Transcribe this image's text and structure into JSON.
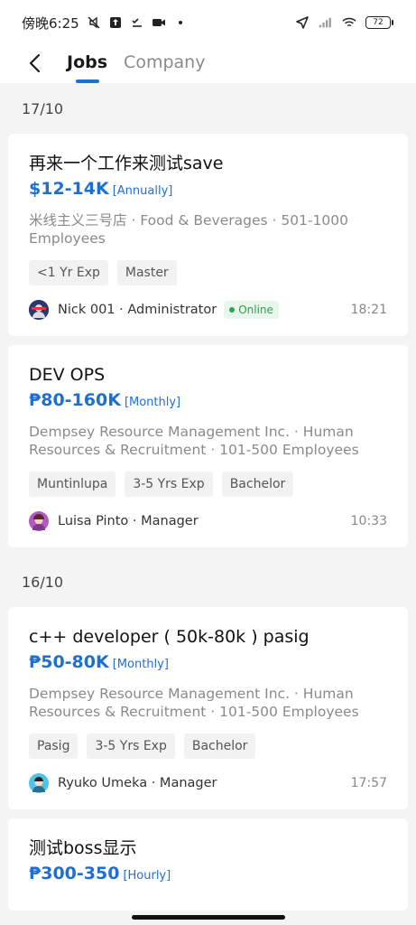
{
  "status_bar": {
    "time": "傍晚6:25",
    "battery": "72"
  },
  "nav": {
    "tabs": [
      {
        "label": "Jobs",
        "active": true
      },
      {
        "label": "Company",
        "active": false
      }
    ]
  },
  "groups": [
    {
      "date": "17/10",
      "jobs": [
        {
          "title": "再来一个工作来测试save",
          "salary": "$12-14K",
          "period": "[Annually]",
          "company": "米线主义三号店 · Food & Beverages · 501-1000 Employees",
          "tags": [
            "<1 Yr Exp",
            "Master"
          ],
          "recruiter": "Nick 001 · Administrator",
          "online": "Online",
          "time": "18:21"
        },
        {
          "title": "DEV OPS",
          "salary": "₱80-160K",
          "period": "[Monthly]",
          "company": "Dempsey Resource Management Inc. · Human Resources & Recruitment · 101-500 Employees",
          "tags": [
            "Muntinlupa",
            "3-5 Yrs Exp",
            "Bachelor"
          ],
          "recruiter": "Luisa Pinto · Manager",
          "time": "10:33"
        }
      ]
    },
    {
      "date": "16/10",
      "jobs": [
        {
          "title": "c++ developer ( 50k-80k ) pasig",
          "salary": "₱50-80K",
          "period": "[Monthly]",
          "company": "Dempsey Resource Management Inc. · Human Resources & Recruitment · 101-500 Employees",
          "tags": [
            "Pasig",
            "3-5 Yrs Exp",
            "Bachelor"
          ],
          "recruiter": "Ryuko Umeka · Manager",
          "time": "17:57"
        },
        {
          "title": "测试boss显示",
          "salary": "₱300-350",
          "period": "[Hourly]"
        }
      ]
    }
  ],
  "colors": {
    "accent": "#1f6fd1",
    "online": "#2ea24d"
  }
}
